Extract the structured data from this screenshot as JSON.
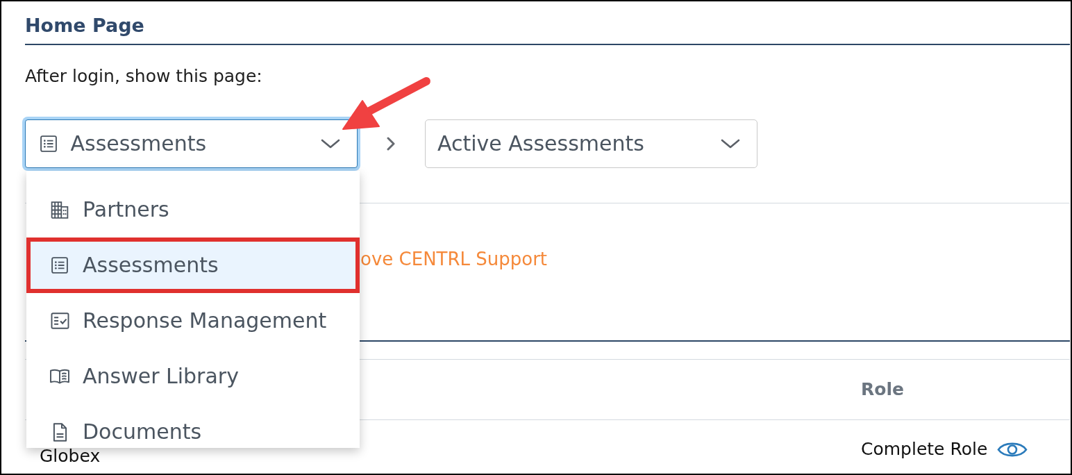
{
  "section": {
    "title": "Home Page"
  },
  "prompt": "After login, show this page:",
  "selects": [
    {
      "kind": "list",
      "value": "Assessments",
      "expanded": true,
      "options": [
        {
          "kind": "building",
          "label": "Partners",
          "selected": false,
          "outlined": false
        },
        {
          "kind": "list",
          "label": "Assessments",
          "selected": true,
          "outlined": true
        },
        {
          "kind": "checklist",
          "label": "Response Management",
          "selected": false,
          "outlined": false
        },
        {
          "kind": "book",
          "label": "Answer Library",
          "selected": false,
          "outlined": false
        },
        {
          "kind": "document",
          "label": "Documents",
          "selected": false,
          "outlined": false
        }
      ]
    },
    {
      "kind": "plain",
      "value": "Active Assessments",
      "expanded": false
    }
  ],
  "support_link": "ove CENTRL Support",
  "table": {
    "role_header": "Role",
    "rows": [
      {
        "column_1": "Globex",
        "role": "Complete Role"
      }
    ]
  },
  "annotations": [
    {
      "kind": "arrow"
    }
  ]
}
